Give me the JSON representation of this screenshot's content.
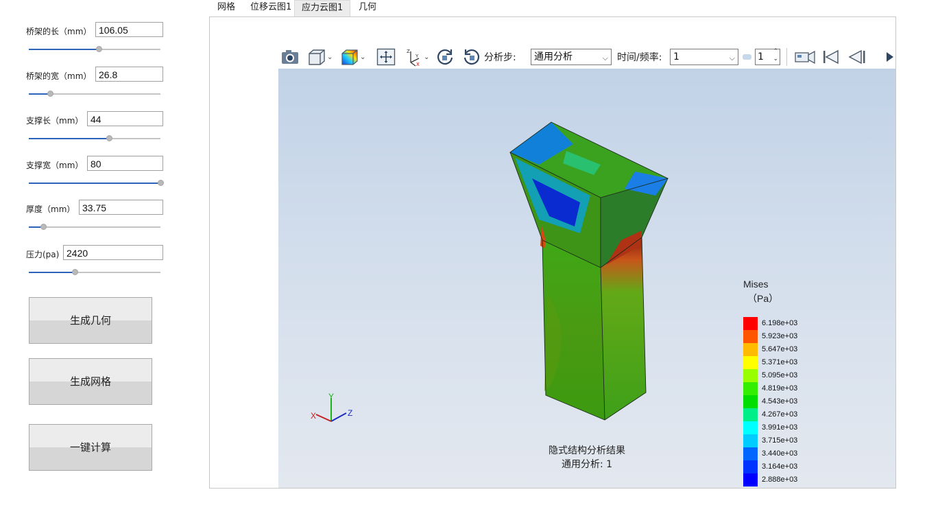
{
  "params": [
    {
      "label": "桥架的长（mm）",
      "value": "106.05",
      "slider": 0.53
    },
    {
      "label": "桥架的宽（mm）",
      "value": "26.8",
      "slider": 0.16
    },
    {
      "label": "支撑长（mm）",
      "value": "44",
      "slider": 0.61
    },
    {
      "label": "支撑宽（mm）",
      "value": "80",
      "slider": 1.0
    },
    {
      "label": "厚度（mm）",
      "value": "33.75",
      "slider": 0.11
    },
    {
      "label": "压力(pa)",
      "value": "2420",
      "slider": 0.35
    }
  ],
  "buttons": {
    "gen_geometry": "生成几何",
    "gen_mesh": "生成网格",
    "compute": "一键计算"
  },
  "tabs": [
    "网格",
    "位移云图1",
    "应力云图1",
    "几何"
  ],
  "active_tab": "应力云图1",
  "toolbar": {
    "step_label": "分析步:",
    "step_value": "通用分析",
    "time_label": "时间/频率:",
    "time_value": "1",
    "frame_value": "1",
    "icons": [
      "camera-icon",
      "view-cube-icon",
      "contour-icon",
      "fit-view-icon",
      "axes-icon",
      "rotate-cw-icon",
      "rotate-ccw-icon",
      "record-camera-icon",
      "first-frame-icon",
      "prev-frame-icon",
      "next-frame-icon"
    ]
  },
  "legend": {
    "title": "Mises",
    "unit": "（Pa）",
    "colors": [
      "#ff0000",
      "#ff5500",
      "#ffbb00",
      "#ffff00",
      "#99ff00",
      "#33ee00",
      "#00dd00",
      "#00ee88",
      "#00ffff",
      "#00ccff",
      "#0066ff",
      "#0033ff",
      "#0000ff"
    ],
    "values": [
      "6.198e+03",
      "5.923e+03",
      "5.647e+03",
      "5.371e+03",
      "5.095e+03",
      "4.819e+03",
      "4.543e+03",
      "4.267e+03",
      "3.991e+03",
      "3.715e+03",
      "3.440e+03",
      "3.164e+03",
      "2.888e+03"
    ]
  },
  "caption": {
    "line1": "隐式结构分析结果",
    "line2": "通用分析: 1"
  },
  "axis_triad": {
    "y": "Y",
    "z": "Z",
    "x": "X"
  }
}
